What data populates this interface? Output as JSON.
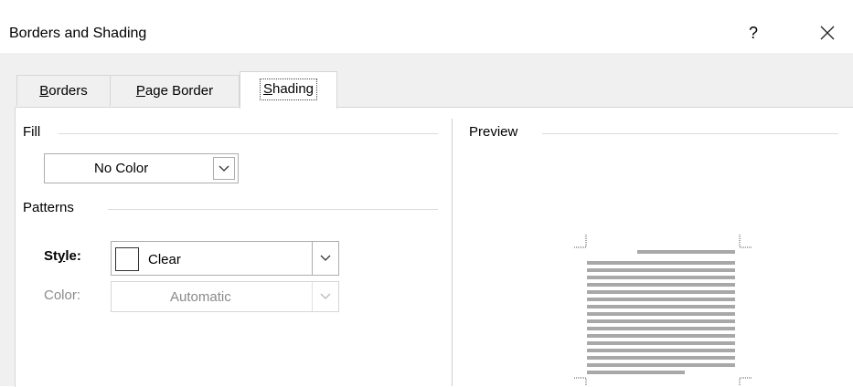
{
  "dialog": {
    "title": "Borders and Shading",
    "help_label": "?"
  },
  "tabs": [
    {
      "label": "Borders",
      "mnemonic": "B",
      "rest": "orders",
      "active": false
    },
    {
      "label": "Page Border",
      "mnemonic": "P",
      "rest": "age Border",
      "active": false
    },
    {
      "label": "Shading",
      "mnemonic": "S",
      "rest": "hading",
      "active": true
    }
  ],
  "fill": {
    "group_label": "Fill",
    "color_value": "No Color"
  },
  "patterns": {
    "group_label": "Patterns",
    "style_label_pre": "St",
    "style_label_mnemonic": "y",
    "style_label_post": "le:",
    "style_value": "Clear",
    "color_label": "Color:",
    "color_value": "Automatic"
  },
  "preview": {
    "group_label": "Preview"
  },
  "colors": {
    "dialog_bg": "#f0f0f0",
    "panel_bg": "#ffffff",
    "border": "#d6d6d6",
    "disabled_text": "#8a8a8a",
    "preview_lines": "#a8a8a8"
  }
}
